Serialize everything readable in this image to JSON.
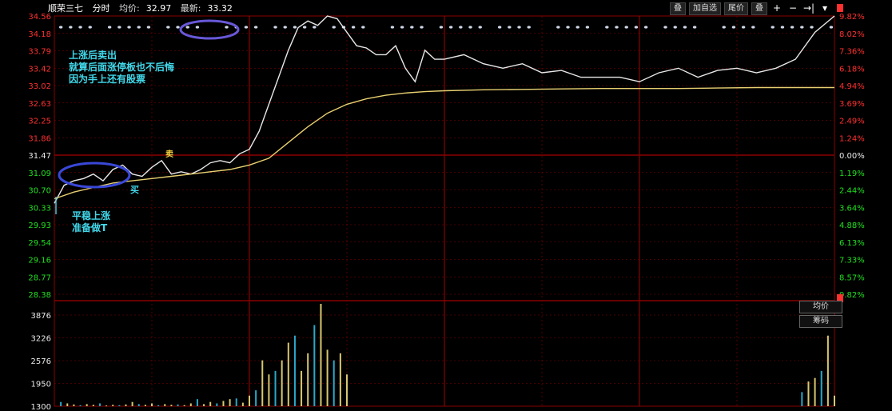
{
  "header": {
    "stock_name": "顺荣三七",
    "mode": "分时",
    "avg_label": "均价:",
    "avg_value": "32.97",
    "latest_label": "最新:",
    "latest_value": "33.32"
  },
  "toolbar": {
    "btn1": "叠",
    "btn2": "加自选",
    "btn3": "尾价",
    "btn4": "叠",
    "plus": "+",
    "minus": "−",
    "arrow": "→|",
    "dropdown": "▾"
  },
  "side_buttons": {
    "avg": "均价",
    "chips": "筹码"
  },
  "annotations": {
    "sell_note": [
      "上涨后卖出",
      "就算后面涨停板也不后悔",
      "因为手上还有股票"
    ],
    "buy_note": [
      "平稳上涨",
      "准备做T"
    ],
    "buy_mark": "买",
    "sell_mark": "卖"
  },
  "colors": {
    "up": "#ff3030",
    "down": "#20e020",
    "price_line": "#e8e8e8",
    "avg_line": "#e8d070",
    "grid": "#8a0000",
    "annotation": "#41d8ea",
    "ellipse": "#3a48d8"
  },
  "chart_data": [
    {
      "type": "line",
      "title": "",
      "y_ticks": [
        "34.56",
        "34.18",
        "33.79",
        "33.42",
        "33.02",
        "32.63",
        "32.25",
        "31.86",
        "31.47",
        "31.09",
        "30.70",
        "30.33",
        "29.93",
        "29.54",
        "29.16",
        "28.77",
        "28.38"
      ],
      "pct_ticks": [
        "9.82%",
        "8.02%",
        "7.36%",
        "6.18%",
        "4.94%",
        "3.69%",
        "2.49%",
        "1.24%",
        "0.00%",
        "1.19%",
        "2.44%",
        "3.64%",
        "4.88%",
        "6.13%",
        "7.33%",
        "8.57%",
        "9.82%"
      ],
      "ylim": [
        28.38,
        34.56
      ],
      "reference_price": 31.47,
      "series": [
        {
          "kind": "price",
          "x": [
            0,
            3,
            6,
            9,
            12,
            15,
            18,
            21,
            24,
            27,
            30,
            33,
            36,
            39,
            42,
            45,
            48,
            51,
            54,
            57,
            60,
            63,
            66,
            69,
            72,
            75,
            78,
            81,
            84,
            87,
            90,
            93,
            96,
            99,
            102,
            105,
            108,
            111,
            114,
            117,
            120,
            126,
            132,
            138,
            144,
            150,
            156,
            162,
            168,
            174,
            180,
            186,
            192,
            198,
            204,
            210,
            216,
            222,
            228,
            234,
            240
          ],
          "y": [
            30.4,
            30.8,
            30.9,
            30.95,
            31.05,
            30.9,
            31.15,
            31.25,
            31.05,
            31.0,
            31.2,
            31.35,
            31.05,
            31.1,
            31.05,
            31.15,
            31.3,
            31.35,
            31.3,
            31.5,
            31.6,
            32.0,
            32.6,
            33.2,
            33.8,
            34.3,
            34.45,
            34.35,
            34.56,
            34.5,
            34.2,
            33.9,
            33.85,
            33.7,
            33.7,
            33.9,
            33.4,
            33.1,
            33.8,
            33.6,
            33.6,
            33.7,
            33.5,
            33.4,
            33.5,
            33.3,
            33.35,
            33.2,
            33.2,
            33.2,
            33.1,
            33.3,
            33.4,
            33.2,
            33.35,
            33.4,
            33.3,
            33.4,
            33.6,
            34.2,
            34.56
          ]
        },
        {
          "kind": "average",
          "x": [
            0,
            6,
            12,
            18,
            24,
            30,
            36,
            42,
            48,
            54,
            60,
            66,
            72,
            78,
            84,
            90,
            96,
            102,
            108,
            114,
            120,
            132,
            144,
            156,
            168,
            180,
            192,
            204,
            216,
            228,
            240
          ],
          "y": [
            30.5,
            30.65,
            30.75,
            30.85,
            30.9,
            30.95,
            31.0,
            31.05,
            31.1,
            31.15,
            31.25,
            31.4,
            31.75,
            32.1,
            32.4,
            32.6,
            32.72,
            32.8,
            32.85,
            32.88,
            32.9,
            32.92,
            32.93,
            32.94,
            32.95,
            32.95,
            32.95,
            32.96,
            32.97,
            32.97,
            32.97
          ]
        }
      ]
    },
    {
      "type": "bar",
      "title": "",
      "y_ticks": [
        "3876",
        "3226",
        "2576",
        "1950",
        "1300"
      ],
      "ylim": [
        1300,
        4200
      ],
      "x": [
        2,
        4,
        6,
        8,
        10,
        12,
        14,
        16,
        18,
        20,
        22,
        24,
        26,
        28,
        30,
        32,
        34,
        36,
        38,
        40,
        42,
        44,
        46,
        48,
        50,
        52,
        54,
        56,
        58,
        60,
        62,
        64,
        66,
        68,
        70,
        72,
        74,
        76,
        78,
        80,
        82,
        84,
        86,
        88,
        90,
        230,
        232,
        234,
        236,
        238,
        240
      ],
      "values": [
        1420,
        1380,
        1350,
        1330,
        1360,
        1340,
        1380,
        1320,
        1340,
        1330,
        1350,
        1420,
        1360,
        1340,
        1380,
        1330,
        1360,
        1340,
        1350,
        1330,
        1380,
        1500,
        1360,
        1420,
        1380,
        1450,
        1500,
        1520,
        1400,
        1600,
        1750,
        2600,
        2200,
        2300,
        2600,
        3100,
        3300,
        2300,
        2800,
        3600,
        4200,
        2900,
        2600,
        2800,
        2200,
        1700,
        2000,
        2100,
        2300,
        3300,
        1600
      ]
    }
  ]
}
